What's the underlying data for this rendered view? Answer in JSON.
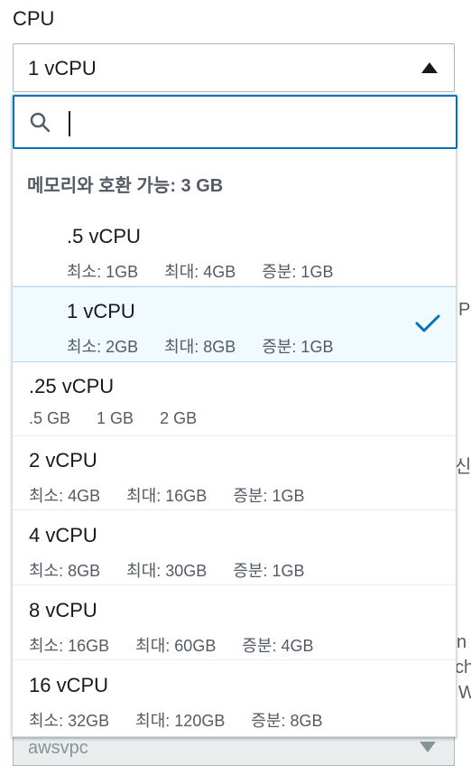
{
  "field": {
    "label": "CPU",
    "selected_value": "1 vCPU"
  },
  "search": {
    "value": "",
    "placeholder": ""
  },
  "group": {
    "header": "메모리와 호환 가능: 3 GB"
  },
  "options_in_group": [
    {
      "label": ".5 vCPU",
      "tags": [
        "최소: 1GB",
        "최대: 4GB",
        "증분: 1GB"
      ],
      "selected": false
    },
    {
      "label": "1 vCPU",
      "tags": [
        "최소: 2GB",
        "최대: 8GB",
        "증분: 1GB"
      ],
      "selected": true
    }
  ],
  "options_other": [
    {
      "label": ".25 vCPU",
      "tags": [
        ".5 GB",
        "1 GB",
        "2 GB"
      ]
    },
    {
      "label": "2 vCPU",
      "tags": [
        "최소: 4GB",
        "최대: 16GB",
        "증분: 1GB"
      ]
    },
    {
      "label": "4 vCPU",
      "tags": [
        "최소: 8GB",
        "최대: 30GB",
        "증분: 1GB"
      ]
    },
    {
      "label": "8 vCPU",
      "tags": [
        "최소: 16GB",
        "최대: 60GB",
        "증분: 4GB"
      ]
    },
    {
      "label": "16 vCPU",
      "tags": [
        "최소: 32GB",
        "최대: 120GB",
        "증분: 8GB"
      ]
    }
  ],
  "background": {
    "peek_pi": "Pl",
    "peek_sin": "신",
    "peek_n": "n",
    "peek_ch": "ch",
    "peek_w": "W",
    "network_mode": "awsvpc"
  },
  "colors": {
    "accent": "#0073bb",
    "selected_bg": "#f1faff",
    "check": "#0073bb"
  }
}
